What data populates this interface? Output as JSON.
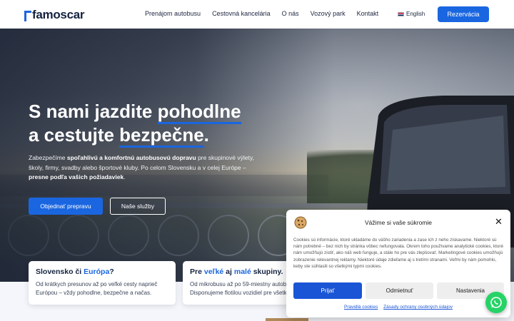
{
  "header": {
    "logo": "famoscar",
    "nav": [
      "Prenájom autobusu",
      "Cestovná kancelária",
      "O nás",
      "Vozový park",
      "Kontakt"
    ],
    "language": "English",
    "reserve_button": "Rezervácia"
  },
  "hero": {
    "title_line1_a": "S nami jazdite ",
    "title_line1_b": "pohodlne",
    "title_line2_a": "a cestujte ",
    "title_line2_b": "bezpečne",
    "title_line2_c": ".",
    "desc_1": "Zabezpečíme ",
    "desc_2": "spoľahlivú a komfortnú autobusovú dopravu",
    "desc_3": " pre skupinové výlety, školy, firmy, svadby alebo športové kluby. Po celom Slovensku a v celej Európe – ",
    "desc_4": "presne podľa vašich požiadaviek",
    "desc_5": ".",
    "primary_button": "Objednať prepravu",
    "secondary_button": "Naše služby"
  },
  "cards": [
    {
      "title_a": "Slovensko či ",
      "title_b": "Európa",
      "title_c": "?",
      "line1": "Od krátkych presunov až po veľké cesty naprieč",
      "line2": "Európou – vždy pohodlne, bezpečne a načas."
    },
    {
      "title_a": "Pre ",
      "title_b": "veľké",
      "title_c": " aj ",
      "title_d": "malé",
      "title_e": " skupiny.",
      "line1": "Od mikrobusu až po 59-miestny autobus.",
      "line2": "Disponujeme flotilou vozidiel pre všetky potreby."
    }
  ],
  "cookie": {
    "title": "Vážime si vaše súkromie",
    "text": "Cookies sú informácie, ktoré ukladáme do vášho zariadenia a zase ich z neho získavame. Niektoré sú nám potrebné – bez nich by stránka vôbec nefungovala. Okrem toho používame analytické cookies, ktoré nám umožňujú zistiť, ako náš web funguje, a stále ho pre vás zlepšovať. Marketingové cookies umožňujú zobrazenie relevantnej reklamy. Niektoré údaje zdieľame aj s tretími stranami. Veľmi by nám pomohlo, keby ste súhlasili so všetkými typmi cookies.",
    "accept": "Prijať",
    "deny": "Odmietnuť",
    "preferences": "Nastavenia",
    "link1": "Pravidlá cookies",
    "link2": "Zásady ochrany osobných údajov"
  },
  "icons": {
    "close": "close-icon",
    "cookie": "cookie-icon",
    "whatsapp": "whatsapp-icon",
    "flag": "uk-flag-icon"
  },
  "colors": {
    "accent": "#1a66e0",
    "whatsapp": "#25d366"
  }
}
